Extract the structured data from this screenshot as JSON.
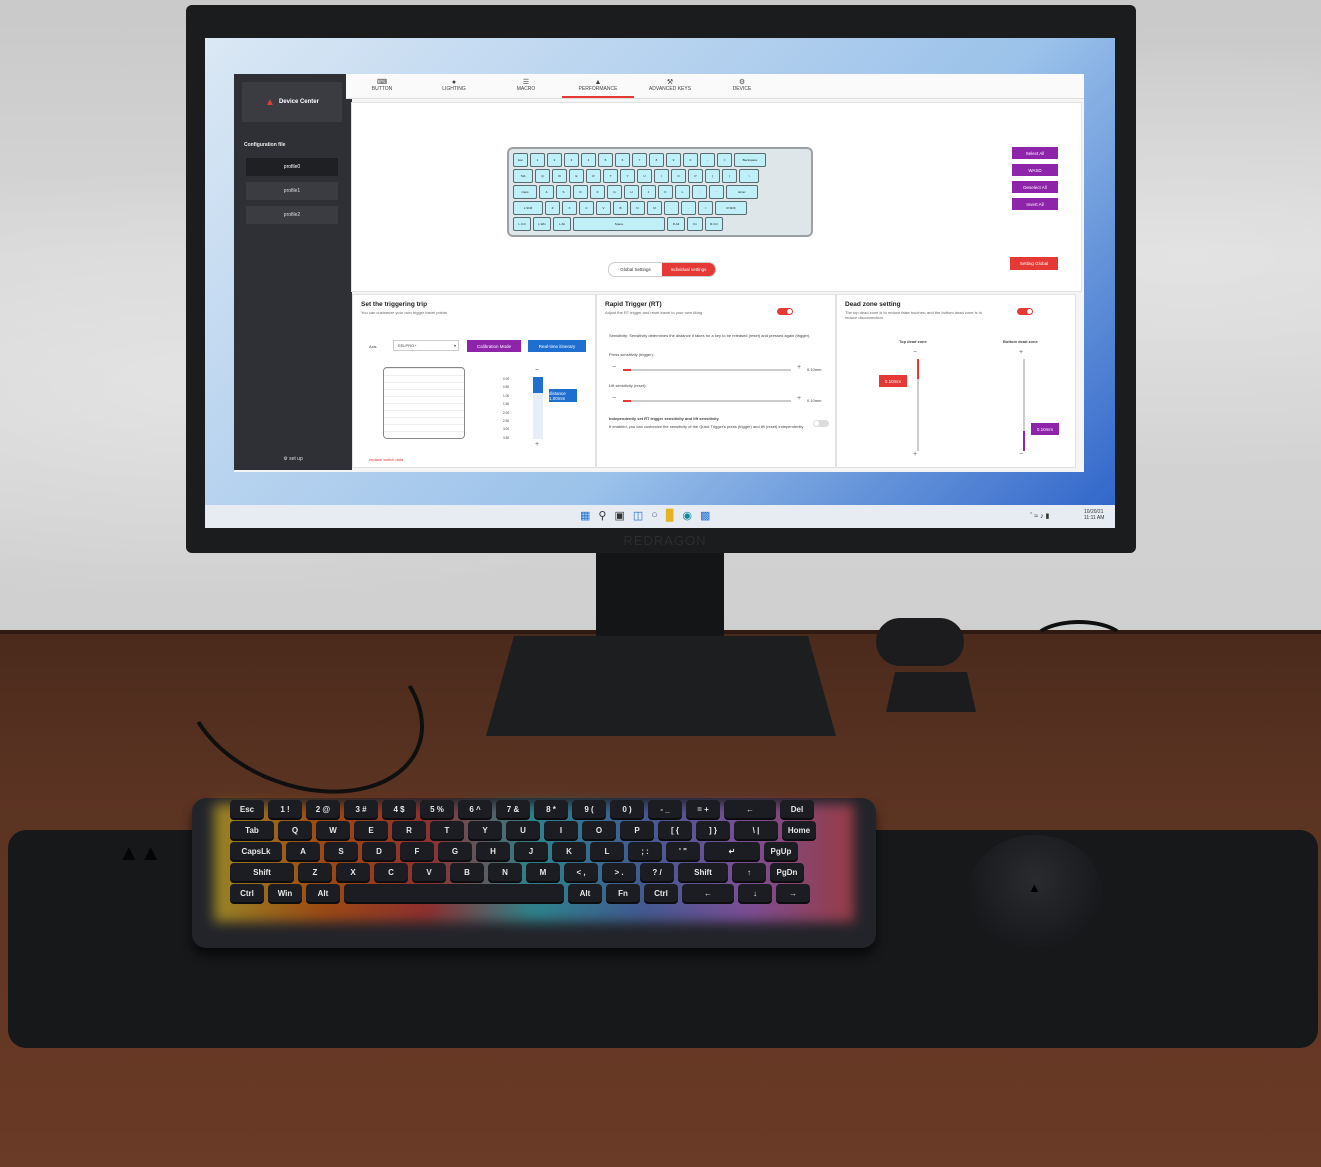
{
  "monitor": {
    "brand": "REDRAGON"
  },
  "app": {
    "logo_text": "Device Center",
    "sidebar": {
      "section_title": "Configuration file",
      "profiles": [
        "profile0",
        "profile1",
        "profile2"
      ],
      "setup_label": "set up"
    },
    "tabs": [
      {
        "label": "BUTTON",
        "icon": "keyboard-icon"
      },
      {
        "label": "LIGHTING",
        "icon": "bulb-icon"
      },
      {
        "label": "MACRO",
        "icon": "macro-icon"
      },
      {
        "label": "PERFORMANCE",
        "icon": "performance-icon",
        "active": true
      },
      {
        "label": "ADVANCED KEYS",
        "icon": "wrench-icon"
      },
      {
        "label": "DEVICE",
        "icon": "gear-icon"
      }
    ],
    "keyboard_actions": [
      "Select All",
      "WASD",
      "Deselect All",
      "Invert All"
    ],
    "setting_global": "Setting Global",
    "mode_segment": {
      "global": "Global Settings",
      "individual": "Individual settings"
    },
    "trigger_panel": {
      "title": "Set the triggering trip",
      "subtitle": "You can customize your own trigger travel points",
      "axis_label": "Axis",
      "axis_value": "EELPRO+",
      "calibration_button": "Calibration Mode",
      "realtime_button": "Real-time itinerary",
      "scale": [
        "0.00",
        "0.50",
        "1.00",
        "1.50",
        "2.00",
        "2.50",
        "3.00",
        "3.50"
      ],
      "distance_tag": "distance 1.00mm",
      "replace_link": "replace switch data"
    },
    "rapid_panel": {
      "title": "Rapid Trigger (RT)",
      "subtitle": "Adjust the RT trigger and reset travel to your own liking",
      "desc": "Sensitivity: Sensitivity determines the distance it takes for a key to be released (reset) and pressed again (trigger).",
      "press_label": "Press sensitivity (trigger):",
      "press_value": "0.10mm",
      "lift_label": "Lift sensitivity (reset):",
      "lift_value": "0.10mm",
      "independent_title": "Independently set RT trigger sensitivity and lift sensitivity",
      "independent_desc": "If enabled, you can customize the sensitivity of the Quick Trigger's press (trigger) and lift (reset) independently"
    },
    "deadzone_panel": {
      "title": "Dead zone setting",
      "subtitle": "The top dead zone is to reduce false touches, and the bottom dead zone is to reduce disconnection.",
      "top_label": "Top dead zone",
      "bottom_label": "Bottom dead zone",
      "top_value": "0.10mm",
      "bottom_value": "0.10mm"
    },
    "accent_red": "#e53935",
    "accent_purple": "#8e24aa",
    "accent_blue": "#1e6fd0"
  },
  "taskbar": {
    "icons": [
      "windows-icon",
      "search-icon",
      "taskview-icon",
      "widgets-icon",
      "chat-icon",
      "folder-icon",
      "edge-icon",
      "store-icon"
    ],
    "clock_time": "11:11 AM",
    "clock_date": "10/20/21"
  },
  "virtual_keyboard": [
    [
      "Esc",
      "1",
      "2",
      "3",
      "4",
      "5",
      "6",
      "7",
      "8",
      "9",
      "0",
      "-",
      "=",
      "Backspace"
    ],
    [
      "Tab",
      "Q",
      "W",
      "E",
      "R",
      "T",
      "Y",
      "U",
      "I",
      "O",
      "P",
      "[",
      "]",
      "\\"
    ],
    [
      "Caps",
      "A",
      "S",
      "D",
      "F",
      "G",
      "H",
      "J",
      "K",
      "L",
      ";",
      "'",
      "Enter"
    ],
    [
      "L.Shift",
      "Z",
      "X",
      "C",
      "V",
      "B",
      "N",
      "M",
      ",",
      ".",
      "/",
      "R.Shift"
    ],
    [
      "L.Ctrl",
      "L.Win",
      "L.Alt",
      "Space",
      "R.Alt",
      "Fn",
      "R.Ctrl"
    ]
  ],
  "physical_keyboard": [
    [
      "Esc",
      "1 !",
      "2 @",
      "3 #",
      "4 $",
      "5 %",
      "6 ^",
      "7 &",
      "8 *",
      "9 (",
      "0 )",
      "- _",
      "= +",
      "←",
      "Del"
    ],
    [
      "Tab",
      "Q",
      "W",
      "E",
      "R",
      "T",
      "Y",
      "U",
      "I",
      "O",
      "P",
      "[ {",
      "] }",
      "\\ |",
      "Home"
    ],
    [
      "CapsLk",
      "A",
      "S",
      "D",
      "F",
      "G",
      "H",
      "J",
      "K",
      "L",
      "; :",
      "' \"",
      "↵",
      "PgUp"
    ],
    [
      "Shift",
      "Z",
      "X",
      "C",
      "V",
      "B",
      "N",
      "M",
      "< ,",
      "> .",
      "? /",
      "Shift",
      "↑",
      "PgDn"
    ],
    [
      "Ctrl",
      "Win",
      "Alt",
      "",
      "Alt",
      "Fn",
      "Ctrl",
      "←",
      "↓",
      "→"
    ]
  ]
}
